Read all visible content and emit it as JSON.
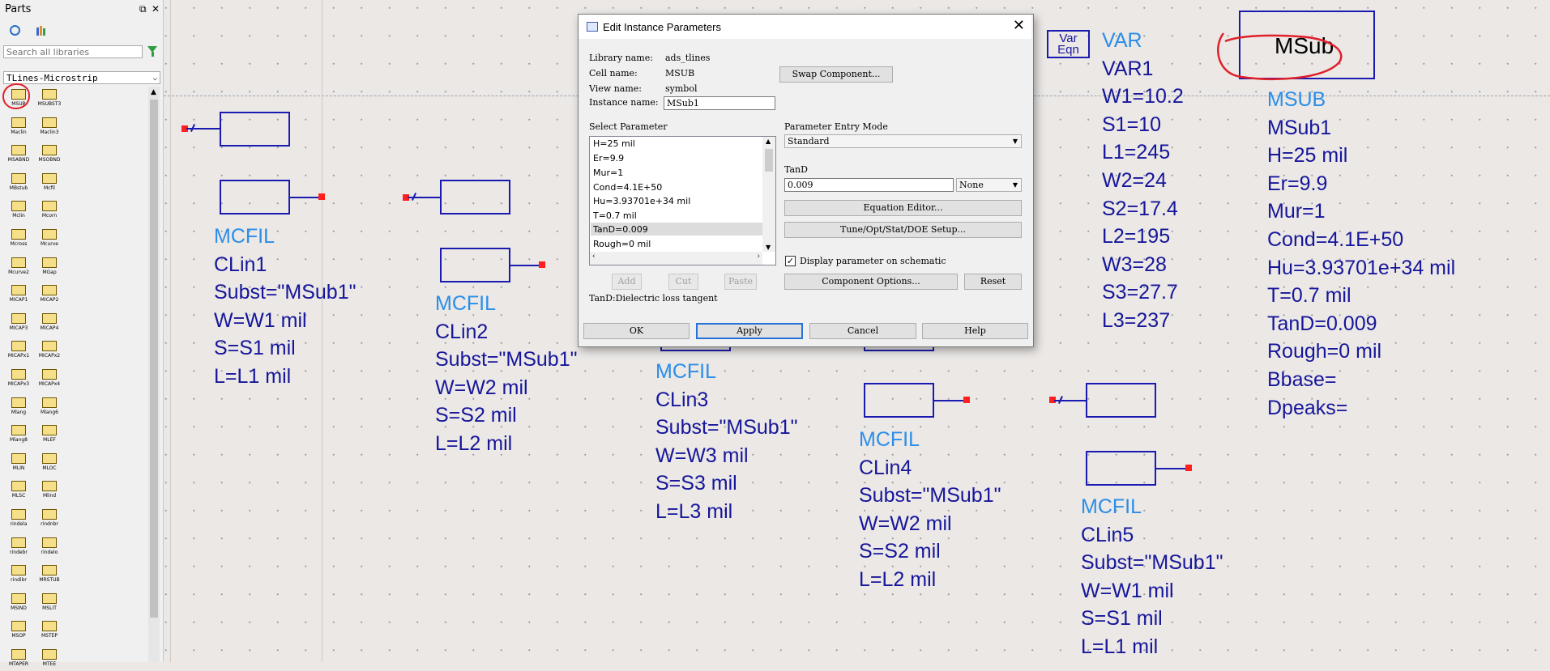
{
  "parts_panel": {
    "title": "Parts",
    "float_button": "⧉",
    "close_button": "✕",
    "search_placeholder": "Search all libraries",
    "library": "TLines-Microstrip",
    "palette": [
      [
        "MSUB",
        "MSUBST3"
      ],
      [
        "Maclin",
        "Maclin3"
      ],
      [
        "MSABND",
        "MSOBND"
      ],
      [
        "MBstub",
        "Mcfil"
      ],
      [
        "Mclin",
        "Mcorn"
      ],
      [
        "Mcross",
        "Mcurve"
      ],
      [
        "Mcurve2",
        "MGap"
      ],
      [
        "MICAP1",
        "MICAP2"
      ],
      [
        "MICAP3",
        "MICAP4"
      ],
      [
        "MICAPx1",
        "MICAPx2"
      ],
      [
        "MICAPx3",
        "MICAPx4"
      ],
      [
        "Mlang",
        "Mlang6"
      ],
      [
        "Mlang8",
        "MLEF"
      ],
      [
        "MLIN",
        "MLOC"
      ],
      [
        "MLSC",
        "Mlind"
      ],
      [
        "rindela",
        "rindnbr"
      ],
      [
        "rindebr",
        "rindelo"
      ],
      [
        "rindibr",
        "MRSTUB"
      ],
      [
        "MSIND",
        "MSLIT"
      ],
      [
        "MSOP",
        "MSTEP"
      ],
      [
        "MTAPER",
        "MTEE"
      ]
    ]
  },
  "schematic": {
    "clin1": {
      "type": "MCFIL",
      "name": "CLin1",
      "subst": "Subst=\"MSub1\"",
      "w": "W=W1 mil",
      "s": "S=S1 mil",
      "l": "L=L1 mil"
    },
    "clin2": {
      "type": "MCFIL",
      "name": "CLin2",
      "subst": "Subst=\"MSub1\"",
      "w": "W=W2 mil",
      "s": "S=S2 mil",
      "l": "L=L2 mil"
    },
    "clin3": {
      "type": "MCFIL",
      "name": "CLin3",
      "subst": "Subst=\"MSub1\"",
      "w": "W=W3 mil",
      "s": "S=S3 mil",
      "l": "L=L3 mil"
    },
    "clin4": {
      "type": "MCFIL",
      "name": "CLin4",
      "subst": "Subst=\"MSub1\"",
      "w": "W=W2 mil",
      "s": "S=S2 mil",
      "l": "L=L2 mil"
    },
    "clin5": {
      "type": "MCFIL",
      "name": "CLin5",
      "subst": "Subst=\"MSub1\"",
      "w": "W=W1 mil",
      "s": "S=S1 mil",
      "l": "L=L1 mil"
    },
    "vareqn": {
      "line1": "Var",
      "line2": "Eqn"
    },
    "var": {
      "type": "VAR",
      "name": "VAR1",
      "items": [
        "W1=10.2",
        "S1=10",
        "L1=245",
        "W2=24",
        "S2=17.4",
        "L2=195",
        "W3=28",
        "S3=27.7",
        "L3=237"
      ]
    },
    "msub": {
      "box_label": "MSub",
      "type": "MSUB",
      "name": "MSub1",
      "items": [
        "H=25 mil",
        "Er=9.9",
        "Mur=1",
        "Cond=4.1E+50",
        "Hu=3.93701e+34 mil",
        "T=0.7 mil",
        "TanD=0.009",
        "Rough=0 mil",
        "Bbase=",
        "Dpeaks="
      ]
    }
  },
  "dialog": {
    "title": "Edit Instance Parameters",
    "library_label": "Library name:",
    "library_value": "ads_tlines",
    "cell_label": "Cell name:",
    "cell_value": "MSUB",
    "view_label": "View name:",
    "view_value": "symbol",
    "instance_label": "Instance name:",
    "instance_value": "MSub1",
    "swap_button": "Swap Component...",
    "select_parameter_label": "Select Parameter",
    "parameters": [
      "H=25 mil",
      "Er=9.9",
      "Mur=1",
      "Cond=4.1E+50",
      "Hu=3.93701e+34 mil",
      "T=0.7 mil",
      "TanD=0.009",
      "Rough=0 mil"
    ],
    "selected_parameter": "TanD=0.009",
    "entry_mode_label": "Parameter Entry Mode",
    "entry_mode_value": "Standard",
    "param_name_label": "TanD",
    "param_value": "0.009",
    "unit_value": "None",
    "equation_editor_button": "Equation Editor...",
    "tune_button": "Tune/Opt/Stat/DOE Setup...",
    "display_checkbox_label": "Display parameter on schematic",
    "display_checked": true,
    "add_button": "Add",
    "cut_button": "Cut",
    "paste_button": "Paste",
    "component_options_button": "Component Options...",
    "reset_button": "Reset",
    "description": "TanD:Dielectric loss tangent",
    "ok_button": "OK",
    "apply_button": "Apply",
    "cancel_button": "Cancel",
    "help_button": "Help"
  }
}
